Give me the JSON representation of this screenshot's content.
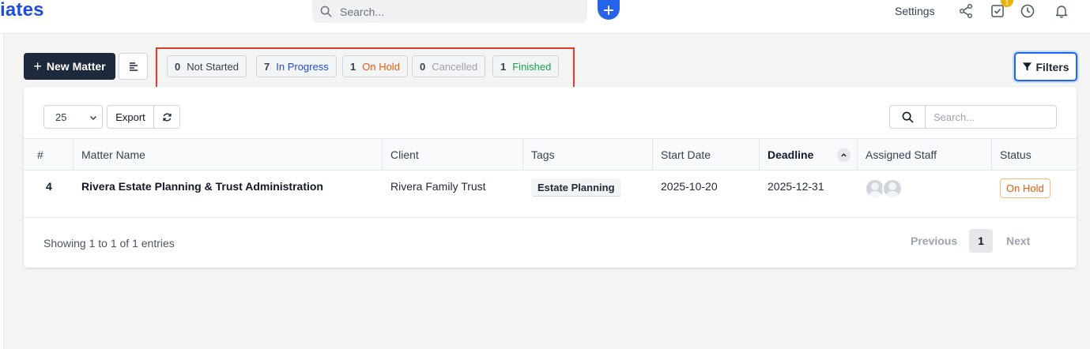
{
  "header": {
    "brand": "iates",
    "search_placeholder": "Search...",
    "settings_label": "Settings",
    "notification_count": "1"
  },
  "toolbar": {
    "new_matter_label": "New Matter",
    "filters_label": "Filters",
    "status_counts": [
      {
        "count": "0",
        "label": "Not Started",
        "color": "#374151"
      },
      {
        "count": "7",
        "label": "In Progress",
        "color": "#1d4ed8"
      },
      {
        "count": "1",
        "label": "On Hold",
        "color": "#ea580c"
      },
      {
        "count": "0",
        "label": "Cancelled",
        "color": "#9ca3af"
      },
      {
        "count": "1",
        "label": "Finished",
        "color": "#16a34a"
      }
    ]
  },
  "table": {
    "per_page": "25",
    "export_label": "Export",
    "search_placeholder": "Search...",
    "columns": [
      "#",
      "Matter Name",
      "Client",
      "Tags",
      "Start Date",
      "Deadline",
      "Assigned Staff",
      "Status"
    ],
    "rows": [
      {
        "id": "4",
        "matter_name": "Rivera Estate Planning & Trust Administration",
        "client": "Rivera Family Trust",
        "tag": "Estate Planning",
        "start_date": "2025-10-20",
        "deadline": "2025-12-31",
        "status": "On Hold"
      }
    ],
    "showing_text": "Showing 1 to 1 of 1 entries",
    "pagination": {
      "previous": "Previous",
      "current": "1",
      "next": "Next"
    }
  }
}
